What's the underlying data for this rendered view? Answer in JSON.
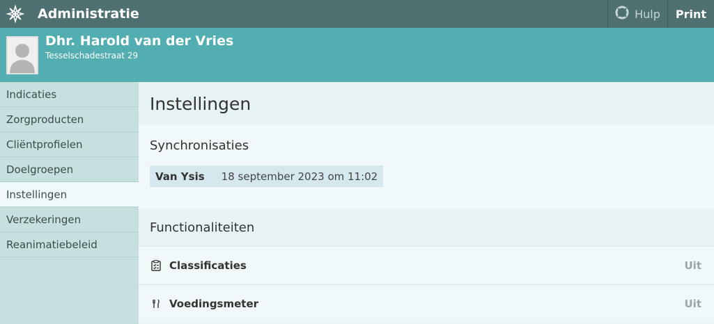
{
  "topbar": {
    "title": "Administratie",
    "help_label": "Hulp",
    "print_label": "Print"
  },
  "client": {
    "name": "Dhr. Harold van der Vries",
    "address": "Tesselschadestraat 29"
  },
  "sidebar": {
    "items": [
      {
        "label": "Indicaties"
      },
      {
        "label": "Zorgproducten"
      },
      {
        "label": "Cliëntprofielen"
      },
      {
        "label": "Doelgroepen"
      },
      {
        "label": "Instellingen",
        "active": true
      },
      {
        "label": "Verzekeringen"
      },
      {
        "label": "Reanimatiebeleid"
      }
    ]
  },
  "main": {
    "title": "Instellingen",
    "sync": {
      "heading": "Synchronisaties",
      "name": "Van Ysis",
      "date": "18 september 2023 om 11:02"
    },
    "functions": {
      "heading": "Functionaliteiten",
      "rows": [
        {
          "icon": "clipboard-check-icon",
          "label": "Classificaties",
          "state": "Uit"
        },
        {
          "icon": "fork-knife-icon",
          "label": "Voedingsmeter",
          "state": "Uit"
        }
      ]
    }
  },
  "colors": {
    "topbar": "#4f7070",
    "client_header": "#52aeb0",
    "sidebar": "#c6dfdf"
  }
}
